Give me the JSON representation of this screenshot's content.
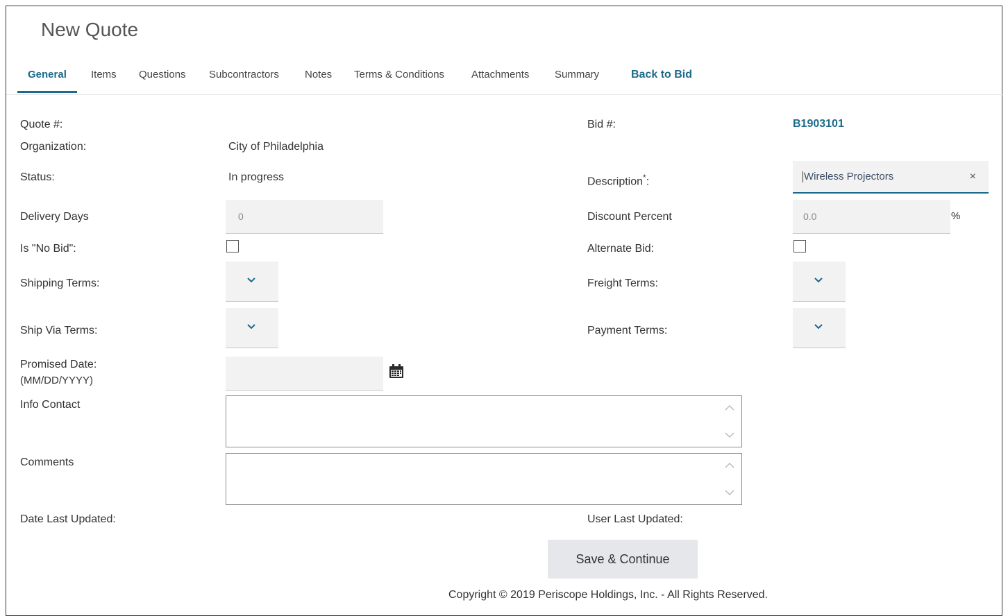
{
  "page": {
    "title": "New Quote"
  },
  "tabs": [
    {
      "label": "General"
    },
    {
      "label": "Items"
    },
    {
      "label": "Questions"
    },
    {
      "label": "Subcontractors"
    },
    {
      "label": "Notes"
    },
    {
      "label": "Terms & Conditions"
    },
    {
      "label": "Attachments"
    },
    {
      "label": "Summary"
    },
    {
      "label": "Back to Bid"
    }
  ],
  "form": {
    "quote_label": "Quote #:",
    "bid_label": "Bid #:",
    "bid_value": "B1903101",
    "organization_label": "Organization:",
    "organization_value": "City of Philadelphia",
    "status_label": "Status:",
    "status_value": "In progress",
    "description_label": "Description",
    "description_required": "*",
    "description_colon": ":",
    "description_value": "Wireless Projectors",
    "description_clear": "×",
    "delivery_label": "Delivery Days",
    "delivery_value": "0",
    "discount_label": "Discount Percent",
    "discount_value": "0.0",
    "discount_unit": "%",
    "no_bid_label": "Is \"No Bid\":",
    "alternate_label": "Alternate Bid:",
    "shipping_label": "Shipping Terms:",
    "freight_label": "Freight Terms:",
    "ship_via_label": "Ship Via Terms:",
    "payment_label": "Payment Terms:",
    "promised_label": "Promised Date:",
    "promised_format": "(MM/DD/YYYY)",
    "info_contact_label": "Info Contact",
    "comments_label": "Comments",
    "date_updated_label": "Date Last Updated:",
    "user_updated_label": "User Last Updated:"
  },
  "actions": {
    "save_label": "Save & Continue"
  },
  "footer": {
    "copyright": "Copyright © 2019 Periscope Holdings, Inc. - All Rights Reserved."
  },
  "icons": {
    "dropdown": "chevron-down-icon",
    "calendar": "calendar-icon",
    "clear": "close-icon"
  },
  "colors": {
    "accent": "#1c6a8a",
    "field_bg": "#f2f2f2"
  }
}
